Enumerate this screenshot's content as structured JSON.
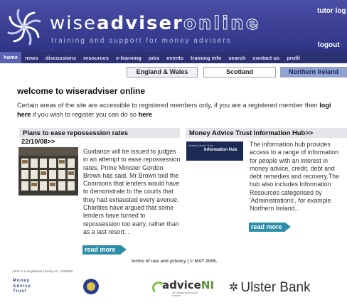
{
  "header": {
    "brand_part1": "wise",
    "brand_part2": "adviser",
    "brand_part3": "online",
    "tagline": "training and support for money advisers",
    "tutor_login": "tutor log",
    "logout": "logout"
  },
  "nav": {
    "items": [
      {
        "label": "home",
        "active": true
      },
      {
        "label": "news"
      },
      {
        "label": "discussions"
      },
      {
        "label": "resources"
      },
      {
        "label": "e-learning"
      },
      {
        "label": "jobs"
      },
      {
        "label": "events"
      },
      {
        "label": "training info"
      },
      {
        "label": "search"
      },
      {
        "label": "contact us"
      },
      {
        "label": "profil"
      }
    ]
  },
  "regions": {
    "england_wales": "England & Wales",
    "scotland": "Scotland",
    "northern_ireland": "Northern Ireland"
  },
  "welcome": {
    "title": "welcome to wiseradviser online",
    "intro_before": "Certain areas of the site are accessible to registered members only, if you are a registered member then ",
    "intro_login": "logi",
    "intro_here1": "here",
    "intro_middle": " if you wish to register you can do so ",
    "intro_here2": "here"
  },
  "left_article": {
    "heading": "Plans to ease repossession rates",
    "date": "22/10/08>>",
    "body": "Guidance will be issued to judges in an attempt to ease repossession rates, Prime Minister Gordon Brown has said. Mr Brown told the Commons that lenders would have to demonstrate to the courts that they had exhausted every avenue. Charities have argued that some lenders have turned to repossession too early, rather than as a last resort. .",
    "read_more": "read more"
  },
  "right_article": {
    "heading": "Money Advice Trust Information Hub>>",
    "logo_small": "Money Advice Trust",
    "logo_title": "Information Hub",
    "body": "The information hub provides access to a range of information for people with an interest in money advice, credit, debt and debt remedies and recovery.The hub also includes Information Resources categorised by 'Administrations', for example Northern Ireland..",
    "read_more": "read more"
  },
  "footer": {
    "links": "terms of use and privacy | © MAT 2006.",
    "charity": "MAT is a registered charity no. 1099506",
    "mat_logo": [
      "Money",
      "Advice",
      "Trust"
    ],
    "advice_logo_a": "advice",
    "advice_logo_b": "NI",
    "advice_sub": "the independent advice network",
    "ulster_bank": "Ulster Bank"
  },
  "colors": {
    "header_bg": "#3a3f93",
    "nav_bg": "#2b3173",
    "read_more": "#2d8ea9",
    "region_active": "#8fa2d4"
  }
}
